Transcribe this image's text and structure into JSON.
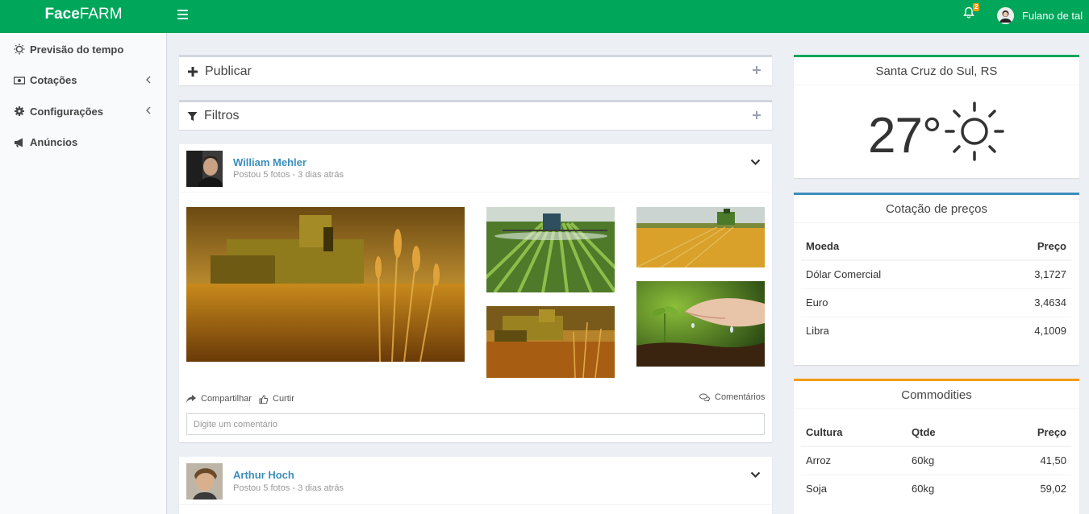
{
  "app": {
    "logo_bold": "Face",
    "logo_rest": "FARM"
  },
  "topbar": {
    "notifications_count": "2",
    "user_name": "Fulano de tal"
  },
  "sidebar": {
    "items": [
      {
        "label": "Previsão do tempo",
        "icon": "sun-icon",
        "has_submenu": false
      },
      {
        "label": "Cotações",
        "icon": "money-icon",
        "has_submenu": true
      },
      {
        "label": "Configurações",
        "icon": "gear-icon",
        "has_submenu": true
      },
      {
        "label": "Anúncios",
        "icon": "megaphone-icon",
        "has_submenu": false
      }
    ]
  },
  "feed": {
    "publish_label": "Publicar",
    "filters_label": "Filtros",
    "posts": [
      {
        "user": "William Mehler",
        "description": "Postou 5 fotos - 3 dias atrás",
        "share_label": "Compartilhar",
        "like_label": "Curtir",
        "comments_label": "Comentários",
        "comment_placeholder": "Digite um comentário"
      },
      {
        "user": "Arthur Hoch",
        "description": "Postou 5 fotos - 3 dias atrás"
      }
    ]
  },
  "weather": {
    "city": "Santa Cruz do Sul, RS",
    "temperature": "27°",
    "condition_icon": "sun-icon"
  },
  "quotes": {
    "title": "Cotação de preços",
    "headers": [
      "Moeda",
      "Preço"
    ],
    "rows": [
      [
        "Dólar Comercial",
        "3,1727"
      ],
      [
        "Euro",
        "3,4634"
      ],
      [
        "Libra",
        "4,1009"
      ]
    ]
  },
  "commodities": {
    "title": "Commodities",
    "headers": [
      "Cultura",
      "Qtde",
      "Preço"
    ],
    "rows": [
      [
        "Arroz",
        "60kg",
        "41,50"
      ],
      [
        "Soja",
        "60kg",
        "59,02"
      ]
    ]
  },
  "colors": {
    "brand_green": "#00a65a",
    "link_blue": "#3c8dbc",
    "quotes_accent": "#3c8dbc",
    "commodities_accent": "#f39c12",
    "badge": "#f39c12"
  }
}
